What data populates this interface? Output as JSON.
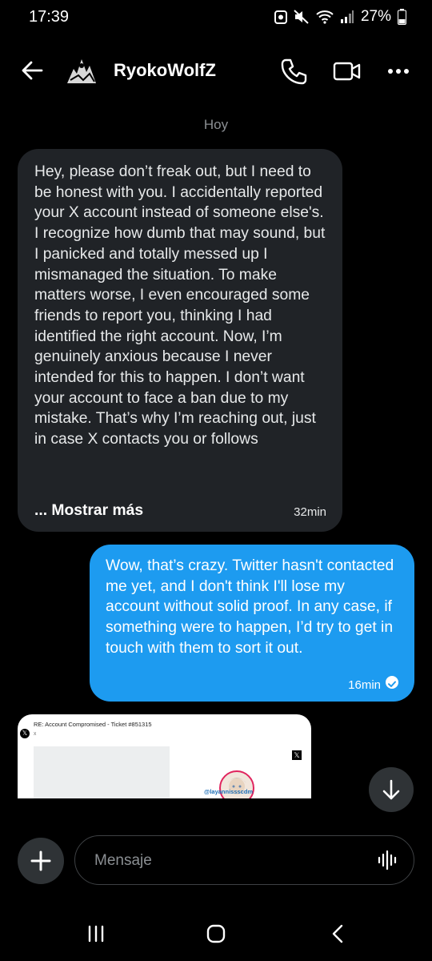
{
  "status_bar": {
    "time": "17:39",
    "battery": "27%",
    "icons": [
      "notification-app-icon",
      "mute-icon",
      "wifi-icon",
      "signal-icon",
      "battery-icon"
    ]
  },
  "header": {
    "contact_name": "RyokoWolfZ",
    "icons": [
      "back-arrow-icon",
      "phone-icon",
      "video-icon",
      "more-icon"
    ]
  },
  "conversation": {
    "date_label": "Hoy",
    "messages": [
      {
        "direction": "received",
        "text": "Hey, please don’t freak out, but I need to be honest with you. I accidentally reported your X account instead of someone else's. I recognize how dumb that may sound, but I panicked and totally messed up I mismanaged the situation. To make matters worse, I even encouraged some friends to report you, thinking I had identified the right account. Now, I’m genuinely anxious because I never intended for this to happen. I don’t want your account to face a ban due to my mistake. That’s why I’m reaching out, just in case X contacts you or follows",
        "show_more": "... Mostrar más",
        "time": "32min"
      },
      {
        "direction": "sent",
        "text": "Wow, that’s crazy. Twitter hasn't contacted me yet, and I don't think I'll lose my account without solid proof. In any case, if something were to happen, I’d try to get in touch with them to sort it out.",
        "time": "16min",
        "status": "read"
      }
    ],
    "attachment": {
      "title": "RE: Account Compromised - Ticket #851315",
      "sender": "X",
      "handle": "@layannissscdm"
    }
  },
  "composer": {
    "placeholder": "Mensaje"
  },
  "colors": {
    "background": "#000000",
    "received_bubble": "#202327",
    "sent_bubble": "#1d9bf0"
  }
}
